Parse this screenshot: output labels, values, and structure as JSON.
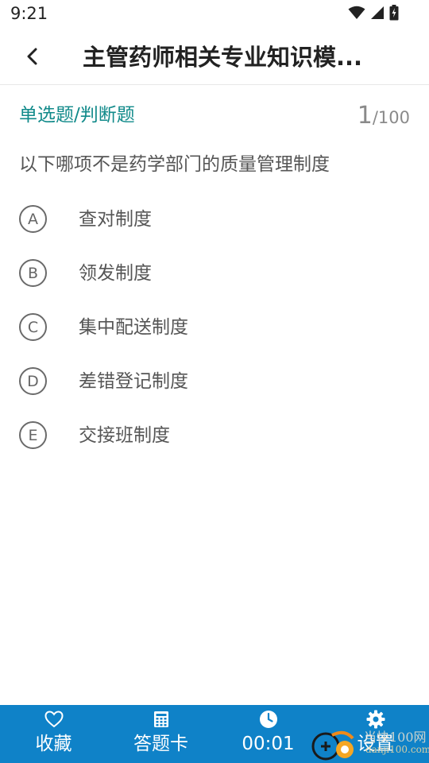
{
  "status_bar": {
    "time": "9:21"
  },
  "header": {
    "title": "主管药师相关专业知识模..."
  },
  "question": {
    "type": "单选题/判断题",
    "current": "1",
    "total": "/100",
    "text": "以下哪项不是药学部门的质量管理制度",
    "options": [
      {
        "letter": "A",
        "text": "查对制度"
      },
      {
        "letter": "B",
        "text": "领发制度"
      },
      {
        "letter": "C",
        "text": "集中配送制度"
      },
      {
        "letter": "D",
        "text": "差错登记制度"
      },
      {
        "letter": "E",
        "text": "交接班制度"
      }
    ]
  },
  "bottom_bar": {
    "favorite_label": "收藏",
    "answer_card_label": "答题卡",
    "timer": "00:01",
    "settings_label": "设置"
  },
  "watermark": {
    "line1": "当快100网",
    "line2": "danji100.com"
  },
  "colors": {
    "accent": "#118a8a",
    "bottom_bar": "#0f82c8",
    "text": "#555555"
  },
  "icons": {
    "back": "chevron-left-icon",
    "favorite": "heart-icon",
    "answer_card": "grid-icon",
    "timer": "clock-icon",
    "settings": "gear-icon"
  }
}
